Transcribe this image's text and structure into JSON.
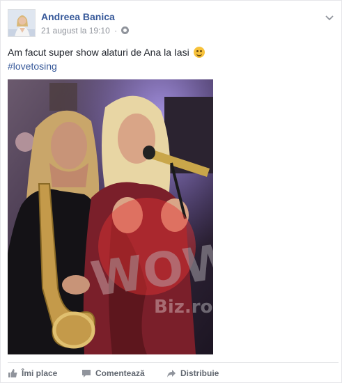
{
  "post": {
    "author": "Andreea Banica",
    "timestamp": "21 august la 19:10",
    "separator": "·",
    "privacy_icon": "globe-icon",
    "text": "Am facut super show alaturi de Ana la Iasi",
    "emoji_icon": "kiss-wink-emoji",
    "hashtag": "#lovetosing"
  },
  "photo": {
    "watermark": "WOW Biz.ro"
  },
  "actions": {
    "like_label": "Îmi place",
    "comment_label": "Comentează",
    "share_label": "Distribuie"
  },
  "colors": {
    "link": "#365899",
    "meta": "#90949c",
    "action": "#616770",
    "border": "#e5e6e9"
  }
}
